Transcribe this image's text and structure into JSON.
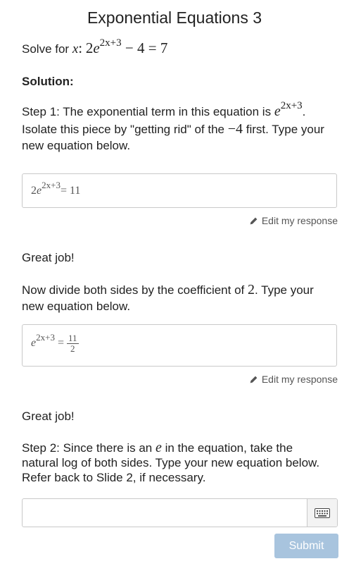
{
  "title": "Exponential Equations 3",
  "problem": {
    "prefix": "Solve for",
    "variable": "x",
    "colon": ":",
    "coef": "2",
    "base": "e",
    "exponent": "2x+3",
    "rest": "− 4 = 7"
  },
  "solution_label": "Solution:",
  "step1": {
    "text_a": "Step 1: The exponential term in this equation is",
    "term_base": "e",
    "term_exp": "2x+3",
    "text_b": ". Isolate this piece by \"getting rid\" of the",
    "term_value": "−4",
    "text_c": "first. Type your new equation below."
  },
  "answer1": {
    "coef": "2",
    "base": "e",
    "exp": "2x+3",
    "rhs": "= 11"
  },
  "edit_label": "Edit my response",
  "feedback1": "Great job!",
  "step1b": {
    "text_a": "Now divide both sides by the coefficient of",
    "coef": "2",
    "text_b": ". Type your new equation below."
  },
  "answer2": {
    "base": "e",
    "exp": "2x+3",
    "eq": "=",
    "num": "11",
    "den": "2"
  },
  "feedback2": "Great job!",
  "step2": {
    "text_a": "Step 2: Since there is an",
    "e": "e",
    "text_b": "in the equation, take the natural log of both sides. Type your new equation below. Refer back to Slide 2, if necessary."
  },
  "input": {
    "value": "",
    "placeholder": ""
  },
  "submit_label": "Submit",
  "colors": {
    "submit_disabled": "#a8c4de",
    "border": "#c9c9c9"
  },
  "icons": {
    "edit": "pencil-icon",
    "keyboard": "keyboard-icon"
  }
}
